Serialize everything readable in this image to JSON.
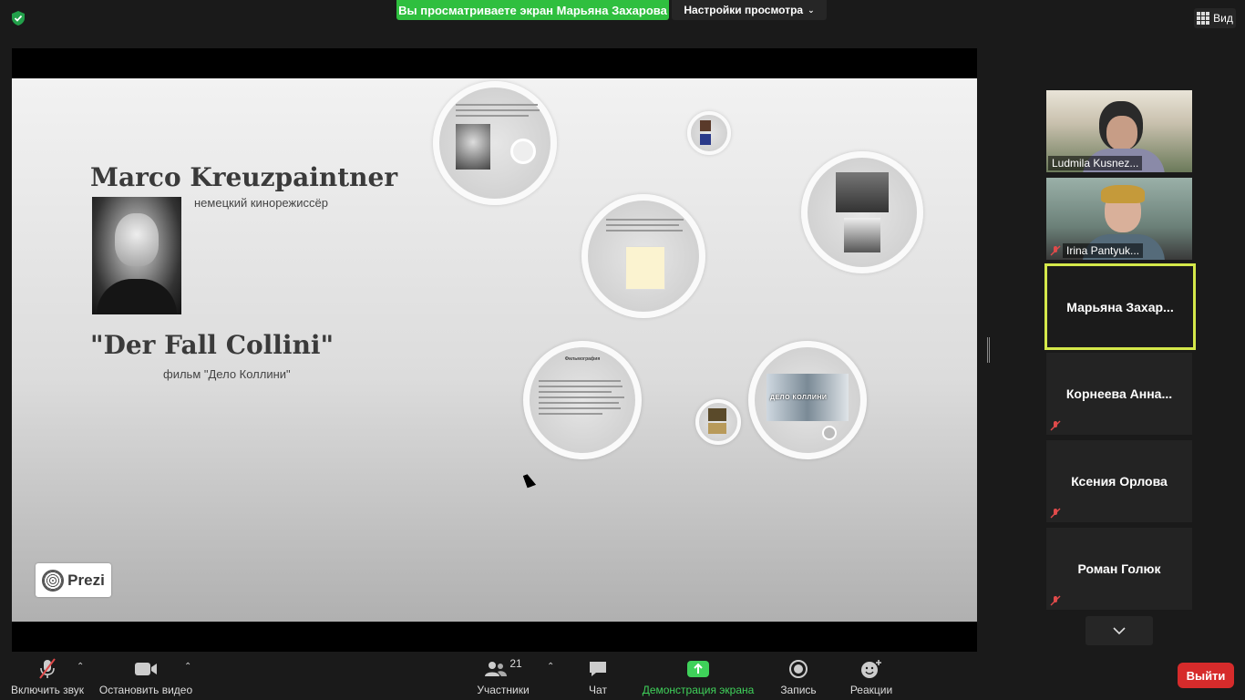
{
  "top": {
    "share_banner": "Вы просматриваете экран Марьяна Захарова",
    "view_options": "Настройки просмотра",
    "view_button": "Вид"
  },
  "slide": {
    "title": "Marco Kreuzpaintner",
    "subtitle": "немецкий кинорежиссёр",
    "film_title": "\"Der Fall Collini\"",
    "film_subtitle": "фильм \"Дело Коллини\"",
    "logo": "Prezi",
    "bubble_labels": {
      "filmography_heading": "Фильмография",
      "film_poster": "ДЕЛО КОЛЛИНИ"
    }
  },
  "participants": [
    {
      "name": "Ludmila Kusnez...",
      "video": true,
      "muted": false
    },
    {
      "name": "Irina Pantyuk...",
      "video": true,
      "muted": true
    },
    {
      "name": "Марьяна  Захар...",
      "video": false,
      "muted": false,
      "active": true
    },
    {
      "name": "Корнеева  Анна...",
      "video": false,
      "muted": true
    },
    {
      "name": "Ксения Орлова",
      "video": false,
      "muted": true
    },
    {
      "name": "Роман Голюк",
      "video": false,
      "muted": true
    }
  ],
  "toolbar": {
    "unmute": "Включить звук",
    "stop_video": "Остановить видео",
    "participants_count": "21",
    "participants": "Участники",
    "chat": "Чат",
    "share_screen": "Демонстрация экрана",
    "record": "Запись",
    "reactions": "Реакции",
    "leave": "Выйти"
  },
  "colors": {
    "share_banner": "#2fbf3f",
    "active_speaker_border": "#d4e84a",
    "leave": "#d62b2b",
    "share_icon": "#3fd15a"
  }
}
